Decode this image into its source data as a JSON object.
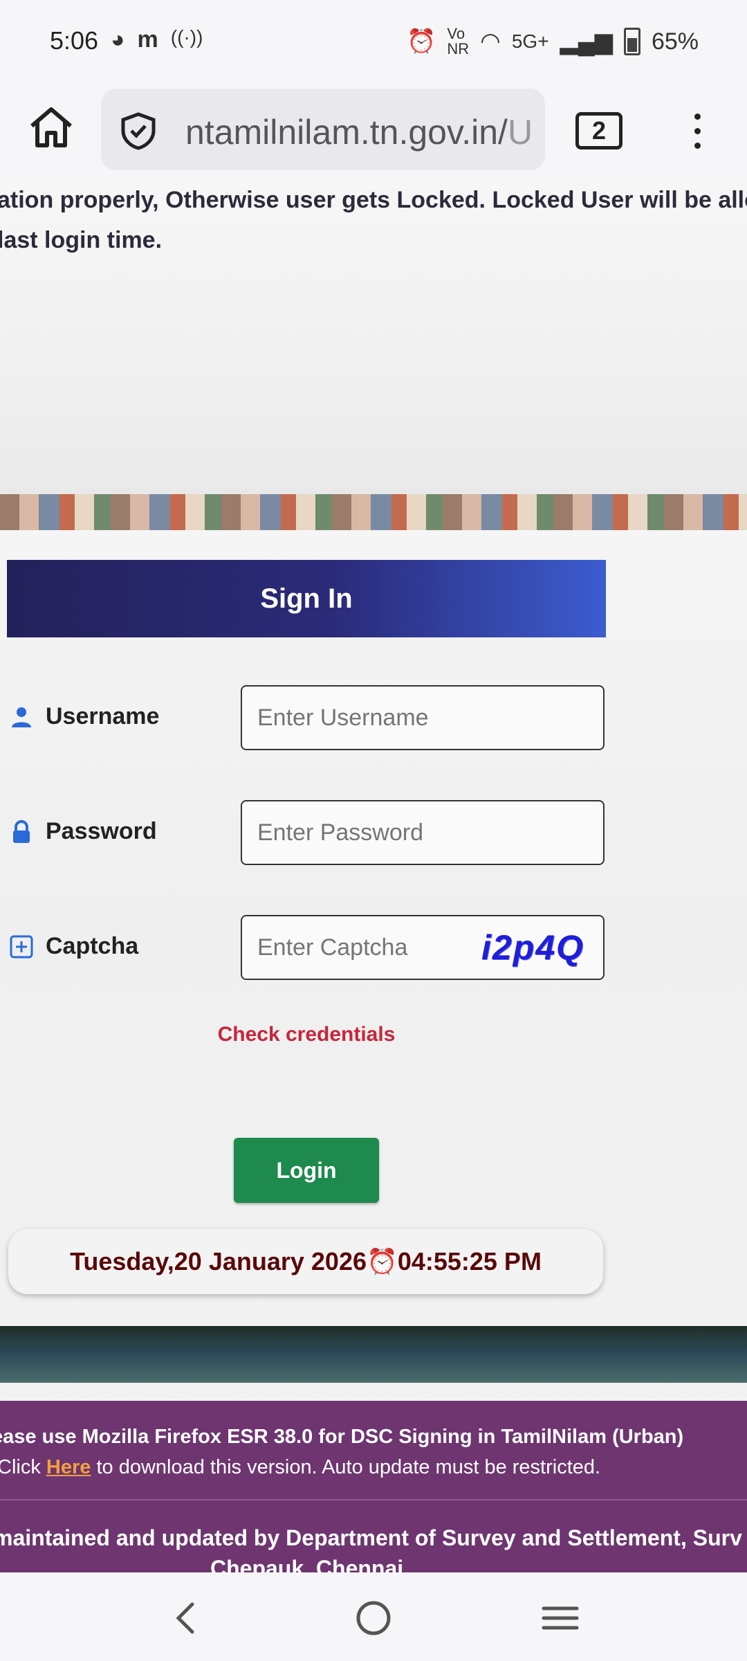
{
  "status_bar": {
    "time": "5:06",
    "network": "5G+",
    "battery": "65%"
  },
  "browser": {
    "url": "ntamilnilam.tn.gov.in/",
    "url_fade": "U",
    "tab_count": "2"
  },
  "notice": {
    "line1": "ation properly, Otherwise user gets Locked. Locked User will be allo",
    "line2": "last login time."
  },
  "signin": {
    "title": "Sign In",
    "username_label": "Username",
    "username_placeholder": "Enter Username",
    "password_label": "Password",
    "password_placeholder": "Enter Password",
    "captcha_label": "Captcha",
    "captcha_placeholder": "Enter Captcha",
    "captcha_code": "i2p4Q",
    "error": "Check credentials",
    "login_button": "Login"
  },
  "datetime": {
    "date": "Tuesday,20 January  2026",
    "time": "04:55:25 PM"
  },
  "footer": {
    "line1": "ease use Mozilla Firefox ESR 38.0 for DSC Signing in TamilNilam (Urban)",
    "line2_prefix": "Click ",
    "line2_link": "Here",
    "line2_suffix": " to download this version. Auto update must be restricted.",
    "line3": "maintained and updated by Department of Survey and Settlement, Surv",
    "line4": "Chepauk, Chennai."
  },
  "colors": {
    "header_gradient_start": "#23215a",
    "header_gradient_end": "#3c5ccf",
    "login_green": "#1e8a4e",
    "error_red": "#c8253b",
    "footer_purple": "#6e3570",
    "captcha_blue": "#1f1fd6"
  }
}
